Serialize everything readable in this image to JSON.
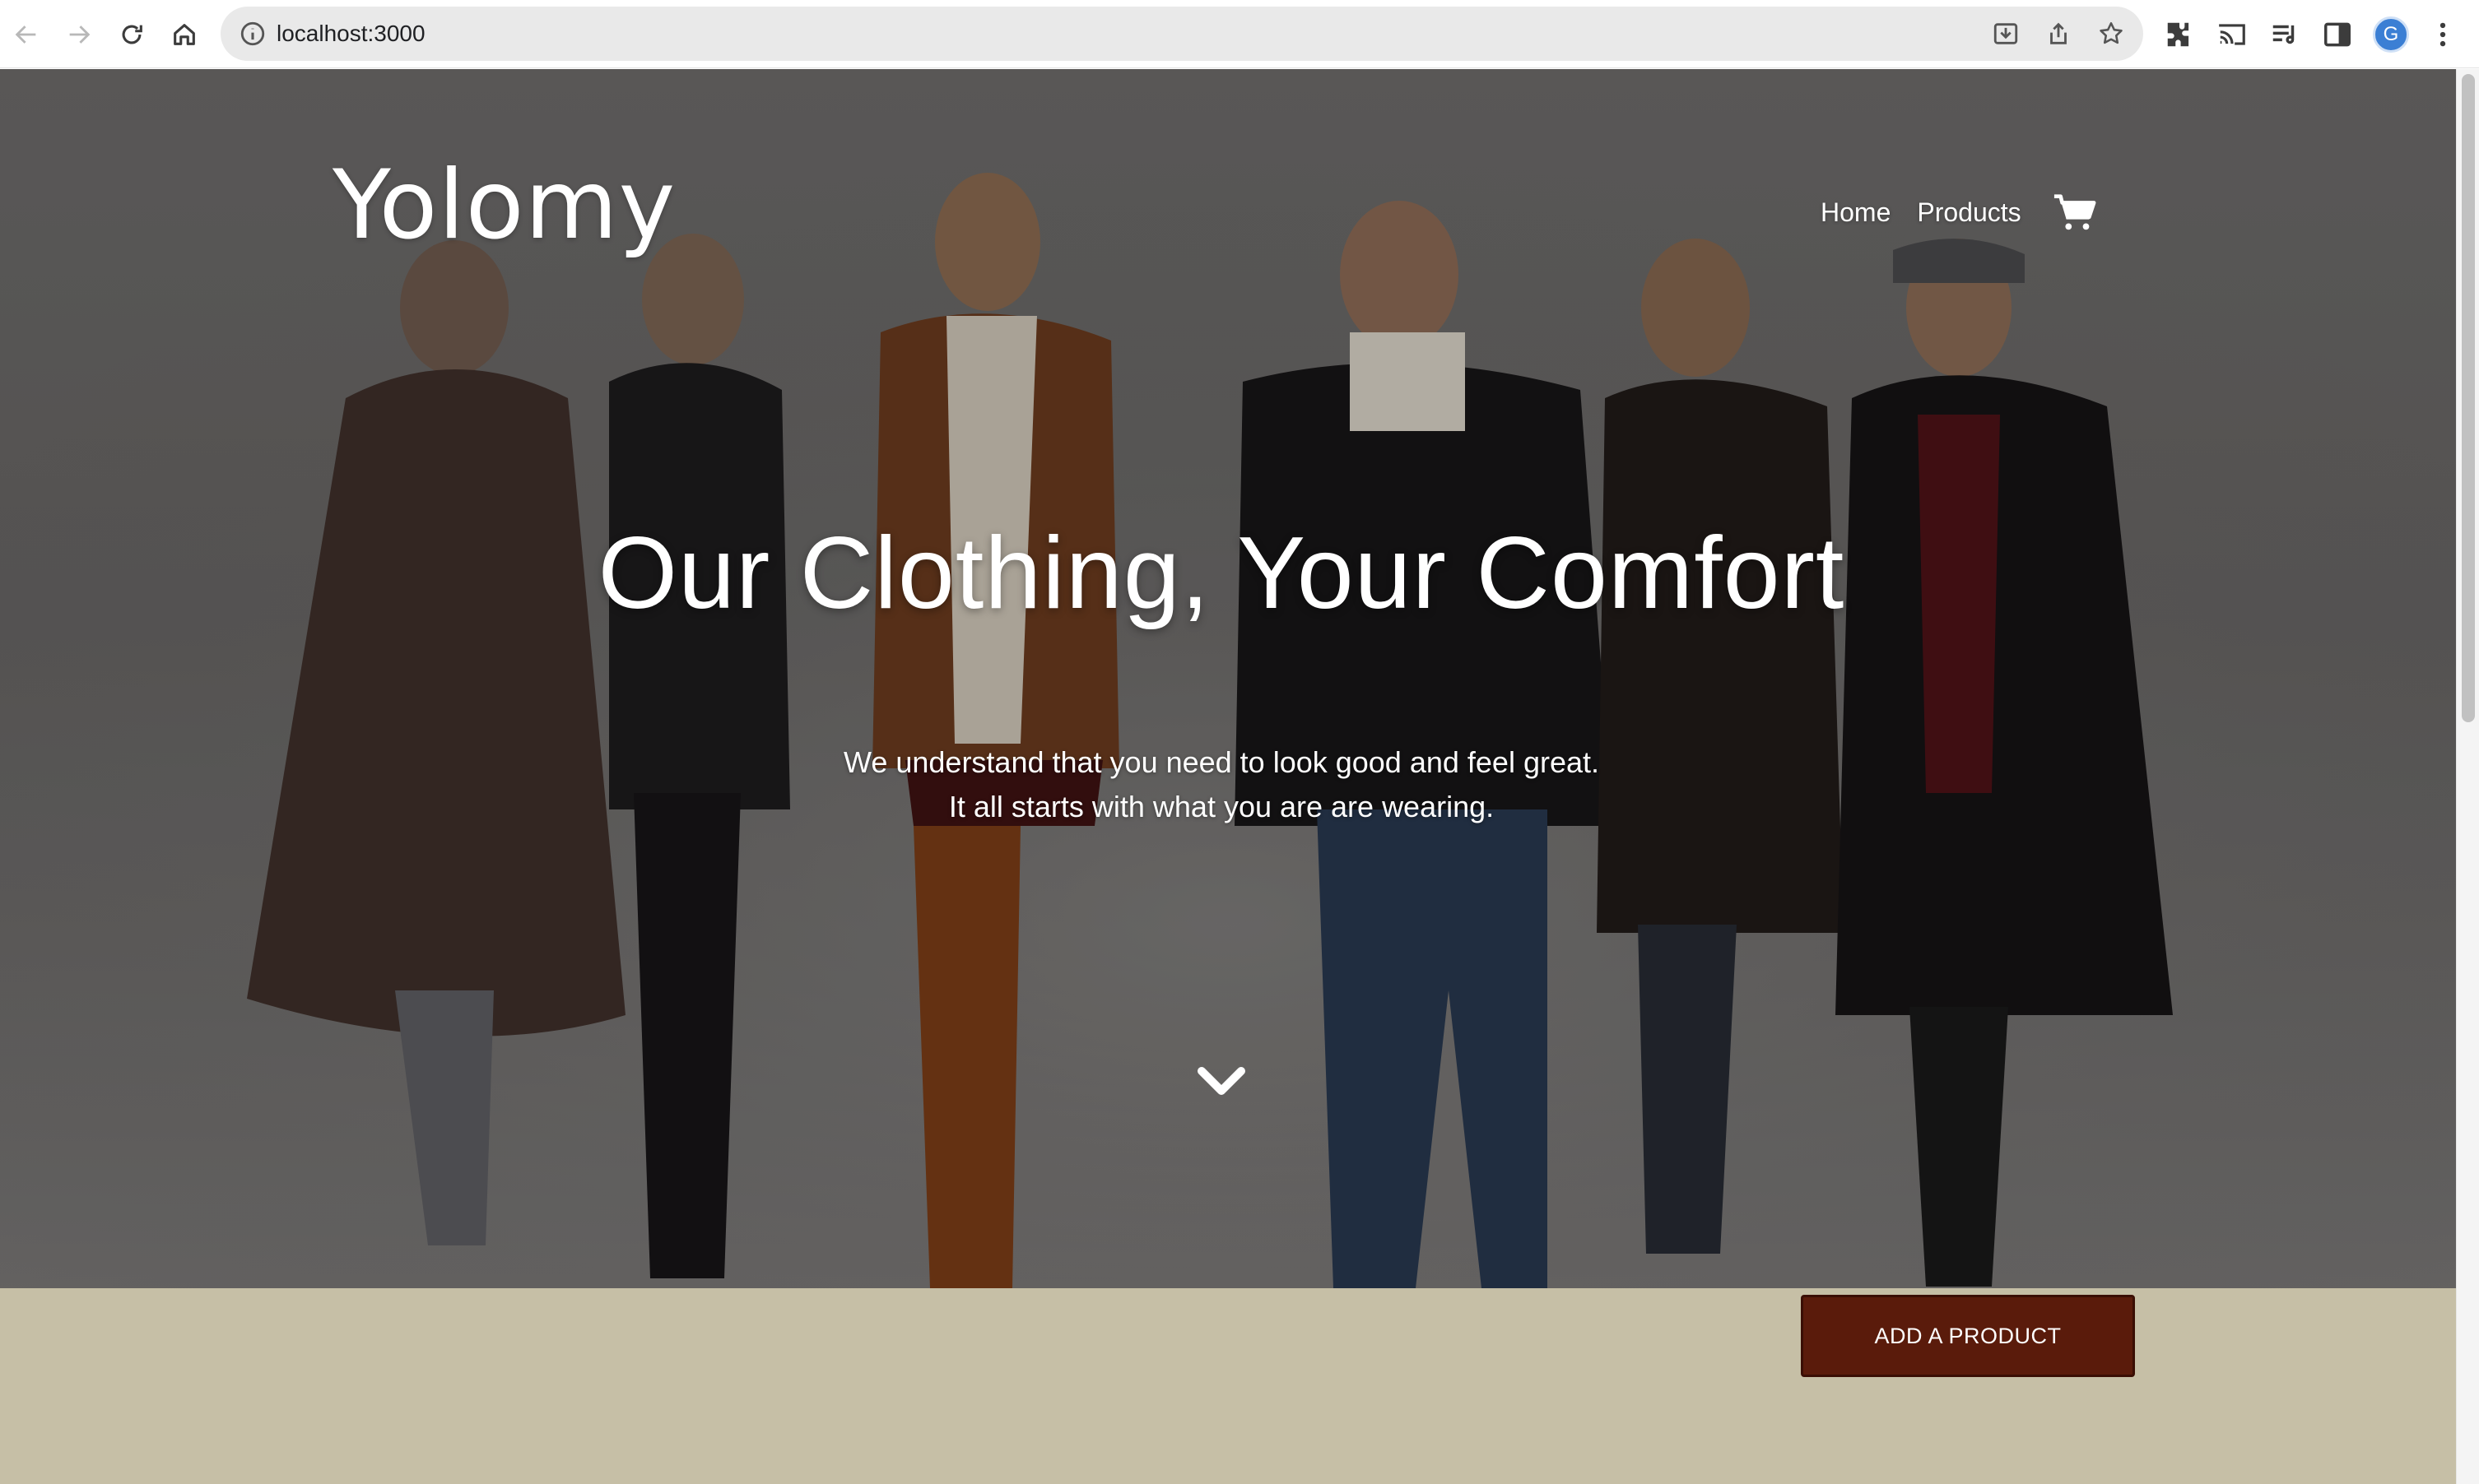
{
  "browser": {
    "url": "localhost:3000",
    "profile_initial": "G",
    "icons": [
      "back-arrow-icon",
      "forward-arrow-icon",
      "reload-icon",
      "home-icon",
      "site-info-icon",
      "install-app-icon",
      "share-icon",
      "bookmark-star-icon",
      "extensions-puzzle-icon",
      "cast-icon",
      "reading-list-icon",
      "side-panel-icon",
      "more-menu-icon"
    ]
  },
  "site": {
    "brand": "Yolomy",
    "nav": {
      "home": "Home",
      "products": "Products"
    }
  },
  "hero": {
    "headline": "Our Clothing, Your Comfort",
    "subline_1": "We understand that you need to look good and feel great.",
    "subline_2": "It all starts with what you are are wearing."
  },
  "products": {
    "add_button": "ADD A PRODUCT"
  },
  "colors": {
    "button_bg": "#5a1b0b",
    "band_bg": "#c6bfa6",
    "omnibox_bg": "#e9e9e9",
    "avatar_bg": "#3b7fd4"
  }
}
